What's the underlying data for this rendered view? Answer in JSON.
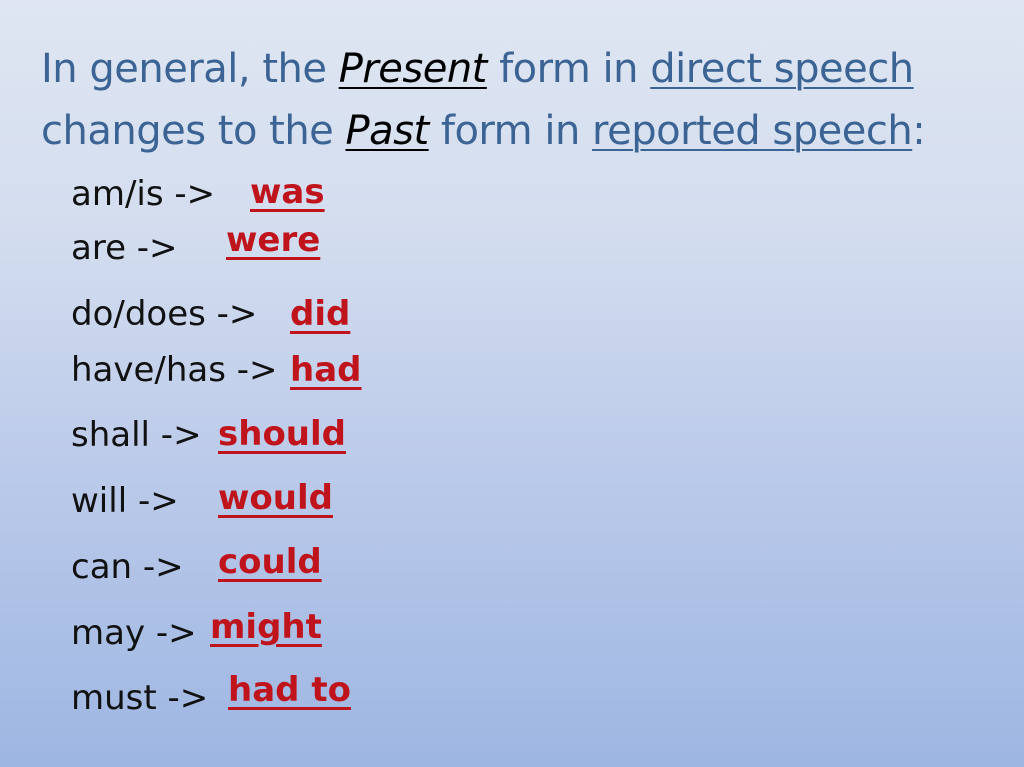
{
  "heading": {
    "line1": {
      "pre": "In general, the ",
      "em": "Present",
      "mid": " form in ",
      "ul": "direct speech"
    },
    "line2": {
      "pre": "changes to the ",
      "em": "Past",
      "mid": " form in ",
      "ul": "reported speech",
      "post": ":"
    }
  },
  "colors": {
    "heading": "#3b6495",
    "answer": "#c0141c",
    "text": "#111111"
  },
  "conversions": [
    {
      "present": "am/is ->",
      "past": "was"
    },
    {
      "present": "are ->",
      "past": "were"
    },
    {
      "present": "do/does ->",
      "past": "did"
    },
    {
      "present": "have/has ->",
      "past": "had"
    },
    {
      "present": "shall ->",
      "past": "should"
    },
    {
      "present": "will ->",
      "past": "would"
    },
    {
      "present": "can ->",
      "past": "could"
    },
    {
      "present": "may ->",
      "past": "might"
    },
    {
      "present": "must ->",
      "past": "had to"
    }
  ]
}
